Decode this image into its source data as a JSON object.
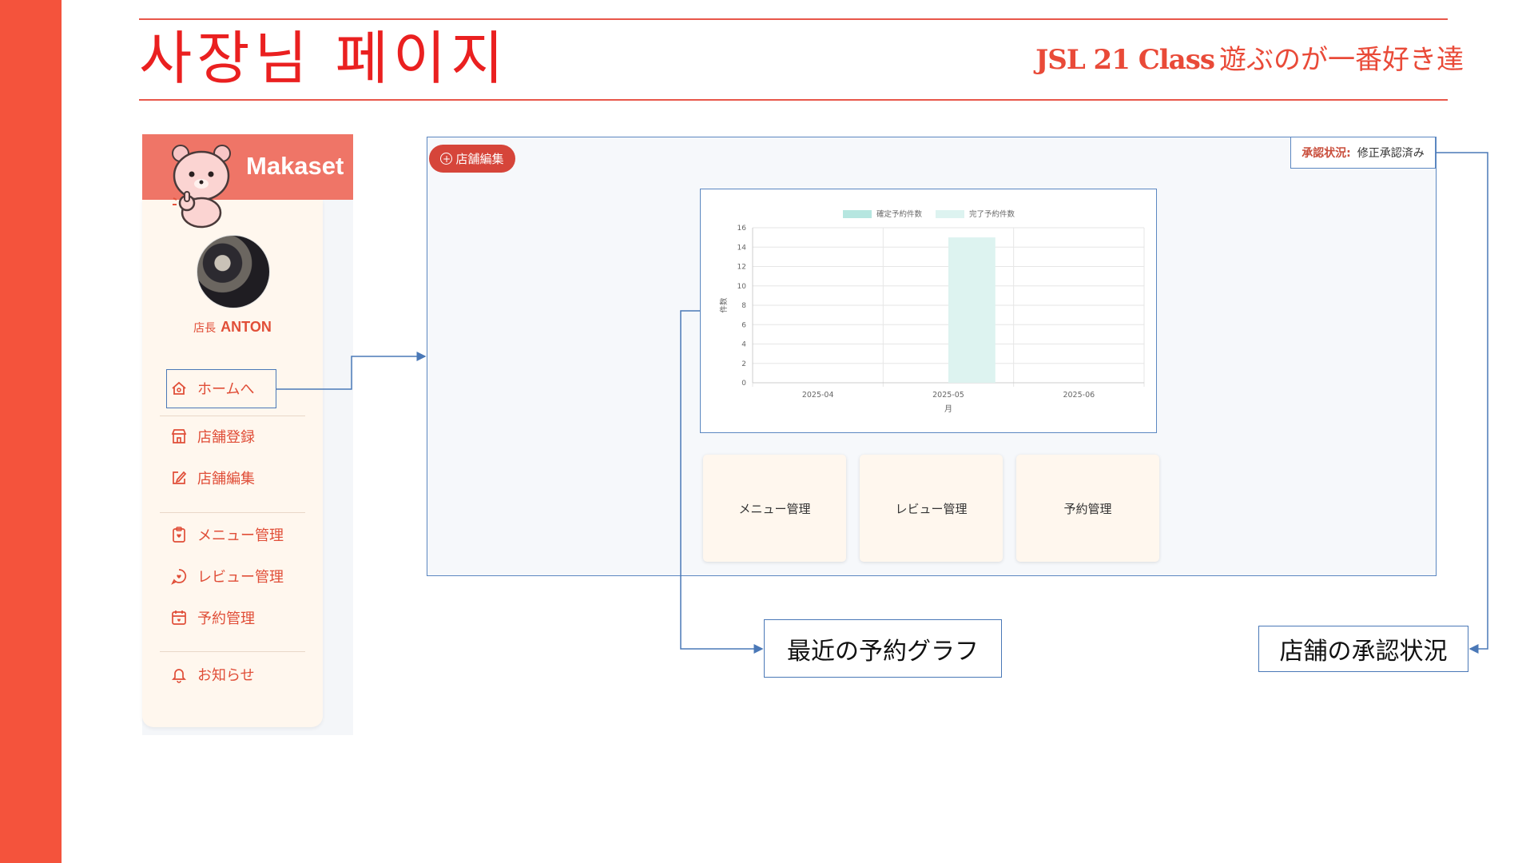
{
  "header": {
    "title": "사장님 페이지",
    "class_name": "JSL 21 Class",
    "team_name": "遊ぶのが一番好き達"
  },
  "sidebar": {
    "brand": "Makaset",
    "owner_role": "店長",
    "owner_name": "ANTON",
    "items": [
      {
        "label": "ホームへ",
        "icon": "home-icon"
      },
      {
        "label": "店舗登録",
        "icon": "store-icon"
      },
      {
        "label": "店舗編集",
        "icon": "edit-icon"
      },
      {
        "label": "メニュー管理",
        "icon": "menu-clipboard-icon"
      },
      {
        "label": "レビュー管理",
        "icon": "review-bubble-icon"
      },
      {
        "label": "予約管理",
        "icon": "calendar-icon"
      },
      {
        "label": "お知らせ",
        "icon": "bell-icon"
      }
    ]
  },
  "main": {
    "edit_button": "店舗編集",
    "status_label": "承認状況:",
    "status_value": "修正承認済み",
    "cards": [
      "メニュー管理",
      "レビュー管理",
      "予約管理"
    ]
  },
  "chart_data": {
    "type": "bar",
    "categories": [
      "2025-04",
      "2025-05",
      "2025-06"
    ],
    "series": [
      {
        "name": "確定予約件数",
        "values": [
          0,
          0,
          0
        ]
      },
      {
        "name": "完了予約件数",
        "values": [
          0,
          15,
          0
        ]
      }
    ],
    "xlabel": "月",
    "ylabel": "件数",
    "ylim": [
      0,
      16
    ],
    "yticks": [
      0,
      2,
      4,
      6,
      8,
      10,
      12,
      14,
      16
    ],
    "legend": "top",
    "grid": true,
    "colors": [
      "#b6e6e0",
      "#ddf3f0"
    ]
  },
  "callouts": {
    "graph": "最近の予約グラフ",
    "status": "店舗の承認状況"
  },
  "colors": {
    "accent": "#f4533c",
    "title_red": "#ea2020",
    "connector": "#4a78b7"
  }
}
